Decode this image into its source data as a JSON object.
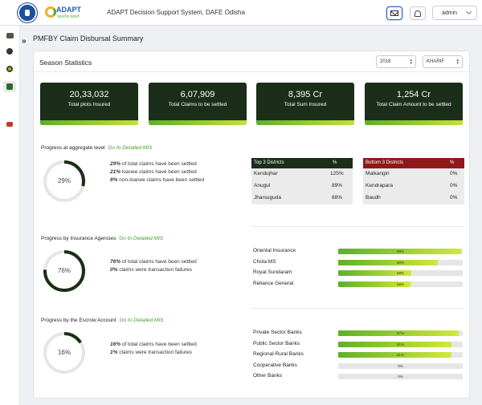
{
  "header": {
    "app_title": "ADAPT Decision Support System, DAFE Odisha",
    "brand": "ADAPT",
    "brand_sub": "ପ୍ରଗତିର ପ୍ରଗତି",
    "user": "admin"
  },
  "page": {
    "title": "PMFBY Claim Disbursal Summary"
  },
  "season": {
    "title": "Season Statistics",
    "year": "2018",
    "season": "KHARIF"
  },
  "stats": [
    {
      "value": "20,33,032",
      "label": "Total plots Insured"
    },
    {
      "value": "6,07,909",
      "label": "Total Claims to be settled"
    },
    {
      "value": "8,395 Cr",
      "label": "Total Sum Insured"
    },
    {
      "value": "1,254 Cr",
      "label": "Total Claim Amount to be settled"
    }
  ],
  "aggregate": {
    "title": "Progress at aggregate level",
    "link": "Go to Detailed MIS",
    "donut_pct": 29,
    "donut_label": "29%",
    "lines": [
      {
        "pct": "29%",
        "text": "of total claims have been settled"
      },
      {
        "pct": "21%",
        "text": "loanee claims have been settled"
      },
      {
        "pct": "8%",
        "text": "non-loanee claims have been settled"
      }
    ],
    "top": {
      "header": "Top 3 Districts",
      "pct_header": "%",
      "rows": [
        [
          "Kendujhar",
          "125%"
        ],
        [
          "Anugul",
          "89%"
        ],
        [
          "Jharsuguda",
          "88%"
        ]
      ]
    },
    "bottom": {
      "header": "Bottom 3 Districts",
      "pct_header": "%",
      "rows": [
        [
          "Malkangiri",
          "0%"
        ],
        [
          "Kendrapara",
          "0%"
        ],
        [
          "Baudh",
          "0%"
        ]
      ]
    }
  },
  "agencies": {
    "title": "Progress by Insurance Agencies",
    "link": "Go to Detailed MIS",
    "donut_pct": 76,
    "donut_label": "76%",
    "lines": [
      {
        "pct": "76%",
        "text": "of total claims have been settled"
      },
      {
        "pct": "0%",
        "text": "claims were transaction failures"
      }
    ],
    "bars": [
      {
        "name": "Oriental Insurance",
        "pct": 99,
        "label": "99%"
      },
      {
        "name": "Chola MS",
        "pct": 80,
        "label": "80%"
      },
      {
        "name": "Royal Sundaram",
        "pct": 59,
        "label": "59%"
      },
      {
        "name": "Reliance General",
        "pct": 58,
        "label": "58%"
      }
    ]
  },
  "escrow": {
    "title": "Progress by the Escrow Account",
    "link": "Go to Detailed MIS",
    "donut_pct": 16,
    "donut_label": "16%",
    "lines": [
      {
        "pct": "16%",
        "text": "of total claims have been settled"
      },
      {
        "pct": "1%",
        "text": "claims were transaction failures"
      }
    ],
    "bars": [
      {
        "name": "Private Sector Banks",
        "pct": 97,
        "label": "97%"
      },
      {
        "name": "Public Sector Banks",
        "pct": 91,
        "label": "91%"
      },
      {
        "name": "Regional Rural Banks",
        "pct": 91,
        "label": "91%"
      },
      {
        "name": "Cooperative Banks",
        "pct": 0,
        "label": "0%"
      },
      {
        "name": "Other Banks",
        "pct": 0,
        "label": "0%"
      }
    ]
  },
  "colors": {
    "dark_green": "#1b2e19",
    "bottom_red": "#8e1a1a",
    "link_green": "#3fa22a"
  },
  "sidebar_icons": [
    "report-icon",
    "settings-icon",
    "globe-icon",
    "check-icon",
    "alert-icon"
  ]
}
